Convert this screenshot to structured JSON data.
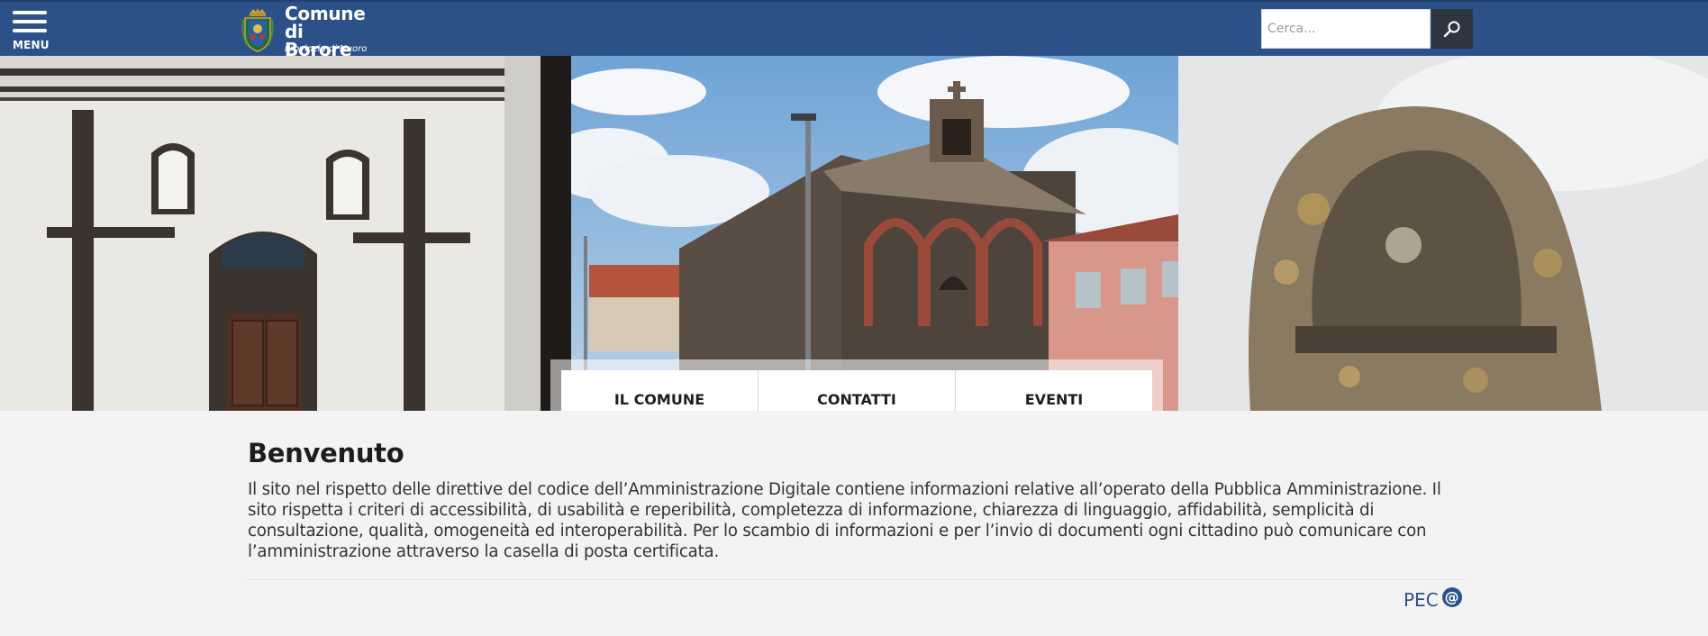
{
  "header": {
    "menu_label": "MENU",
    "site_title_line1": "Comune di",
    "site_title_line2": "Borore",
    "site_subtitle": "Provincia di Nuoro",
    "search_placeholder": "Cerca...",
    "colors": {
      "bar": "#2c5189",
      "search_button": "#2f3540"
    }
  },
  "quicknav": {
    "items": [
      {
        "label": "IL COMUNE"
      },
      {
        "label": "CONTATTI"
      },
      {
        "label": "EVENTI"
      }
    ]
  },
  "main": {
    "title": "Benvenuto",
    "body": "Il sito nel rispetto delle direttive del codice dell’Amministrazione Digitale contiene informazioni relative all’operato della Pubblica Amministrazione. Il sito rispetta i criteri di accessibilità, di usabilità e reperibilità, completezza di informazione, chiarezza di linguaggio, affidabilità, semplicità di consultazione, qualità, omogeneità ed interoperabilità. Per lo scambio di informazioni e per l’invio di documenti ogni cittadino può comunicare con l’amministrazione attraverso la casella di posta certificata.",
    "pec_label": "PEC",
    "pec_icon": "@"
  },
  "icons": {
    "menu": "hamburger-icon",
    "search": "magnifier-icon",
    "crest": "municipal-crest-icon",
    "pec": "at-sign-icon"
  }
}
